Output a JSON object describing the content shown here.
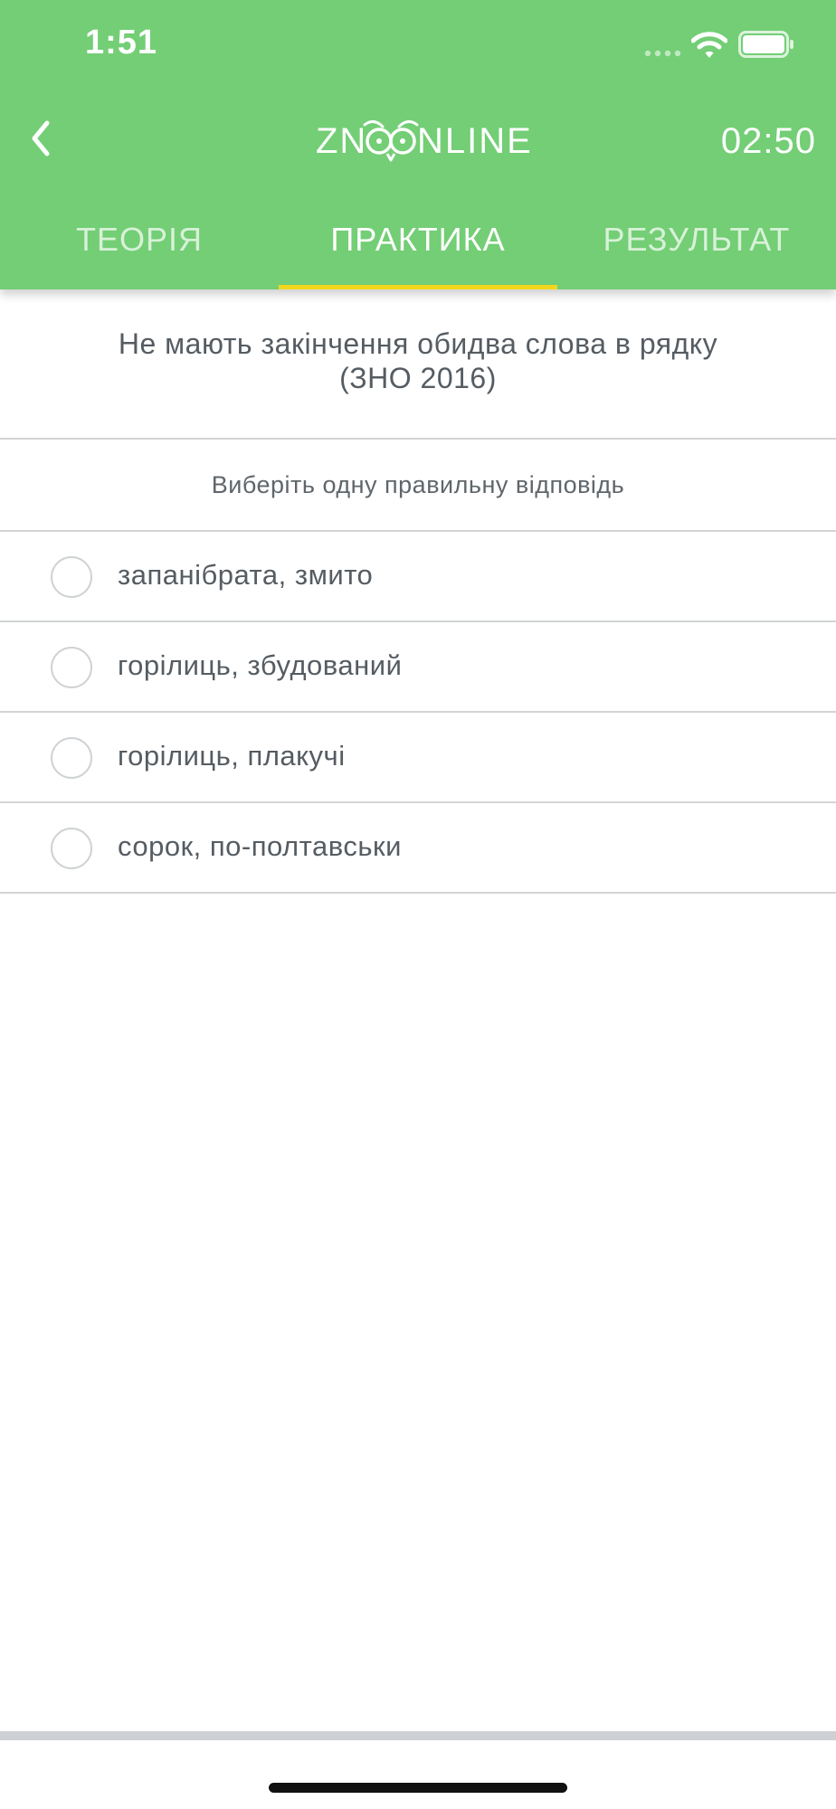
{
  "status_bar": {
    "time": "1:51"
  },
  "header": {
    "logo_left": "ZN",
    "logo_right": "NLINE",
    "timer": "02:50"
  },
  "tabs": [
    {
      "label": "ТЕОРІЯ",
      "active": false
    },
    {
      "label": "ПРАКТИКА",
      "active": true
    },
    {
      "label": "РЕЗУЛЬТАТ",
      "active": false
    }
  ],
  "question": {
    "line1": "Не мають закінчення обидва слова в рядку",
    "line2": "(ЗНО 2016)"
  },
  "instruction": "Виберіть одну правильну відповідь",
  "options": [
    {
      "label": "запанібрата, змито",
      "selected": false
    },
    {
      "label": "горілиць, збудований",
      "selected": false
    },
    {
      "label": "горілиць, плакучі",
      "selected": false
    },
    {
      "label": "сорок, по-полтавськи",
      "selected": false
    }
  ],
  "colors": {
    "header_bg": "#73ce75",
    "tab_indicator": "#f2d71e",
    "text": "#555c62",
    "divider": "#d2d4d6"
  }
}
